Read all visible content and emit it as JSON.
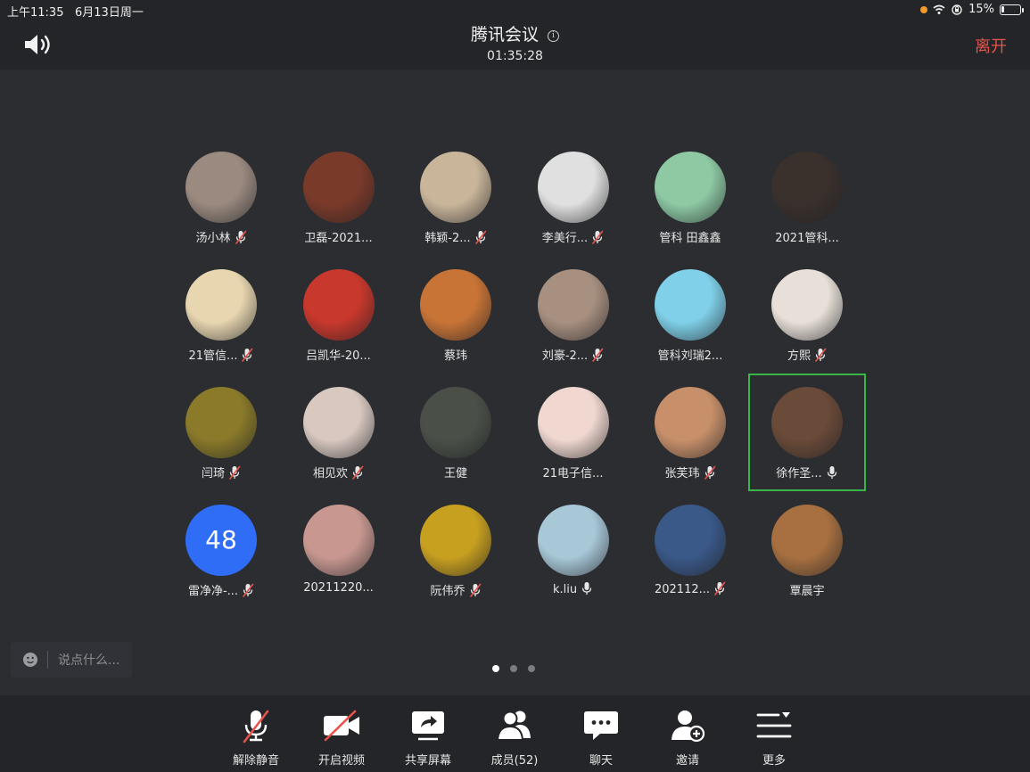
{
  "status": {
    "time": "上午11:35",
    "date": "6月13日周一",
    "battery_percent": "15%",
    "battery_level": 0.15
  },
  "header": {
    "title": "腾讯会议",
    "duration": "01:35:28",
    "leave_label": "离开"
  },
  "participants": [
    {
      "name": "汤小林",
      "mic": "muted",
      "bg": "#9a8a80"
    },
    {
      "name": "卫磊-2021...",
      "mic": "none",
      "bg": "#7a3a2a"
    },
    {
      "name": "韩颖-2...",
      "mic": "muted",
      "bg": "#c9b59a"
    },
    {
      "name": "李美行...",
      "mic": "muted",
      "bg": "#e0e0e0"
    },
    {
      "name": "管科 田鑫鑫",
      "mic": "none",
      "bg": "#8ec9a4"
    },
    {
      "name": "2021管科...",
      "mic": "none",
      "bg": "#3a302c"
    },
    {
      "name": "21管信...",
      "mic": "muted",
      "bg": "#e8d6b0"
    },
    {
      "name": "吕凯华-20...",
      "mic": "none",
      "bg": "#c8382c"
    },
    {
      "name": "蔡玮",
      "mic": "none",
      "bg": "#c87436"
    },
    {
      "name": "刘豪-2...",
      "mic": "muted",
      "bg": "#a89080"
    },
    {
      "name": "管科刘瑞2...",
      "mic": "none",
      "bg": "#7fd0e8"
    },
    {
      "name": "方熙",
      "mic": "muted",
      "bg": "#e8e0d8"
    },
    {
      "name": "闫琦",
      "mic": "muted",
      "bg": "#8a7a2a"
    },
    {
      "name": "相见欢",
      "mic": "muted",
      "bg": "#d8c8c0"
    },
    {
      "name": "王健",
      "mic": "none",
      "bg": "#4a5048"
    },
    {
      "name": "21电子信...",
      "mic": "none",
      "bg": "#f0d8d0"
    },
    {
      "name": "张芙玮",
      "mic": "muted",
      "bg": "#c8906a"
    },
    {
      "name": "徐作圣...",
      "mic": "on",
      "bg": "#6a4a38",
      "active": true
    },
    {
      "name": "雷净净-...",
      "mic": "muted",
      "numeric": "48"
    },
    {
      "name": "20211220...",
      "mic": "none",
      "bg": "#c89890"
    },
    {
      "name": "阮伟乔",
      "mic": "muted",
      "bg": "#c8a020"
    },
    {
      "name": "k.liu",
      "mic": "on",
      "bg": "#a8c8d8"
    },
    {
      "name": "202112...",
      "mic": "muted",
      "bg": "#3a5888"
    },
    {
      "name": "覃晨宇",
      "mic": "none",
      "bg": "#a87040"
    }
  ],
  "chat": {
    "placeholder": "说点什么..."
  },
  "pagination": {
    "total_pages": 3,
    "current_page": 1
  },
  "toolbar": {
    "unmute_label": "解除静音",
    "video_label": "开启视频",
    "share_label": "共享屏幕",
    "members_label": "成员(52)",
    "chat_label": "聊天",
    "invite_label": "邀请",
    "more_label": "更多"
  },
  "colors": {
    "accent_red": "#e8534a",
    "active_border": "#39b54a",
    "background": "#2b2d31",
    "bar": "#242528"
  }
}
